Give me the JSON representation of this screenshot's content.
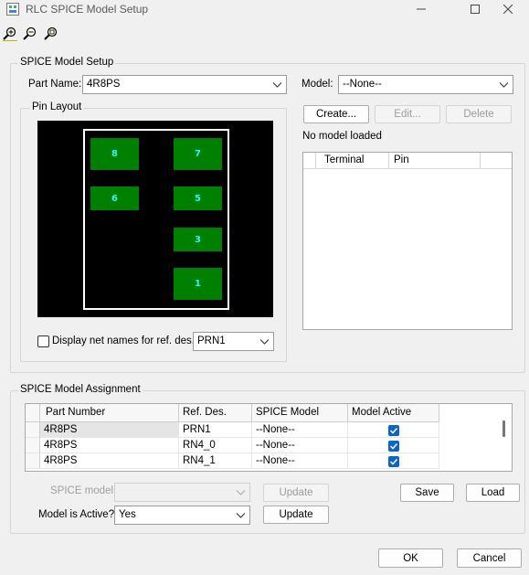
{
  "window": {
    "title": "RLC SPICE Model Setup"
  },
  "toolbar": {
    "icons": [
      "zoom-in-icon",
      "zoom-out-icon",
      "zoom-fit-icon"
    ]
  },
  "setup": {
    "group_label": "SPICE Model Setup",
    "part_name_label": "Part Name:",
    "part_name_value": "4R8PS",
    "model_label": "Model:",
    "model_value": "--None--",
    "create_label": "Create...",
    "edit_label": "Edit...",
    "delete_label": "Delete",
    "status_text": "No model loaded",
    "terminal_table": {
      "headers": [
        "Terminal",
        "Pin"
      ],
      "rows": []
    }
  },
  "pin_layout": {
    "group_label": "Pin Layout",
    "pins": [
      "8",
      "7",
      "6",
      "5",
      "3",
      "1"
    ],
    "display_net_names_label": "Display net names for ref. des.",
    "display_net_names_checked": false,
    "ref_des_value": "PRN1"
  },
  "assignment": {
    "group_label": "SPICE Model Assignment",
    "headers": [
      "Part Number",
      "Ref. Des.",
      "SPICE Model",
      "Model Active"
    ],
    "rows": [
      {
        "part": "4R8PS",
        "ref": "PRN1",
        "model": "--None--",
        "active": true
      },
      {
        "part": "4R8PS",
        "ref": "RN4_0",
        "model": "--None--",
        "active": true
      },
      {
        "part": "4R8PS",
        "ref": "RN4_1",
        "model": "--None--",
        "active": true
      }
    ],
    "spice_model_label": "SPICE model:",
    "spice_model_value": "",
    "update_label": "Update",
    "model_active_label": "Model is Active?",
    "model_active_value": "Yes",
    "update2_label": "Update",
    "save_label": "Save",
    "load_label": "Load"
  },
  "footer": {
    "ok_label": "OK",
    "cancel_label": "Cancel"
  }
}
